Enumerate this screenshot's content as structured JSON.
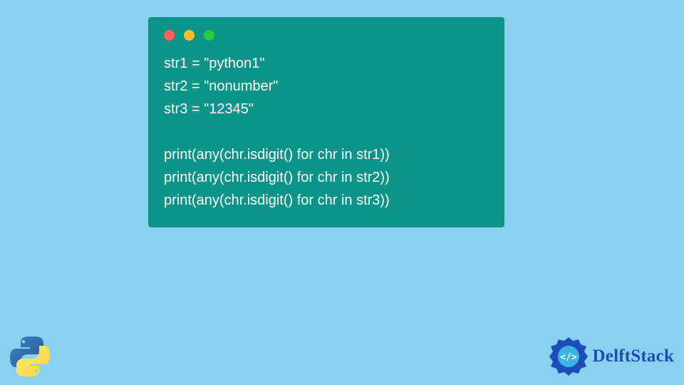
{
  "code": {
    "lines": [
      "str1 = \"python1\"",
      "str2 = \"nonumber\"",
      "str3 = \"12345\"",
      "",
      "print(any(chr.isdigit() for chr in str1))",
      "print(any(chr.isdigit() for chr in str2))",
      "print(any(chr.isdigit() for chr in str3))"
    ]
  },
  "brand": {
    "name": "DelftStack"
  },
  "icons": {
    "window_dots": [
      "red",
      "yellow",
      "green"
    ]
  },
  "colors": {
    "background": "#88d1f1",
    "card": "#0d9488",
    "code_text": "#ffffff",
    "brand_text": "#1e4db7"
  }
}
